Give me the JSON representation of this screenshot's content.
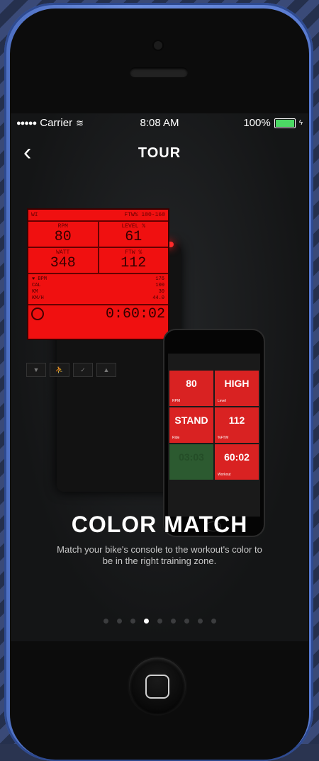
{
  "status_bar": {
    "carrier": "Carrier",
    "time": "8:08 AM",
    "battery": "100%"
  },
  "nav": {
    "back": "‹",
    "title": "TOUR"
  },
  "console": {
    "header_left": "WI",
    "header_right": "FTW% 100-160",
    "rows": [
      {
        "label1": "RPM",
        "value1": "80",
        "label2": "LEVEL %",
        "value2": "61"
      },
      {
        "label1": "WATT",
        "value1": "348",
        "label2": "FTW %",
        "value2": "112"
      }
    ],
    "list": [
      {
        "k": "♥ BPM",
        "v": "176"
      },
      {
        "k": "CAL",
        "v": "100"
      },
      {
        "k": "KM",
        "v": "30"
      },
      {
        "k": "KM/H",
        "v": "44.0"
      }
    ],
    "timer": "0:60:02"
  },
  "mini_app": {
    "tiles": [
      {
        "value": "80",
        "caption": "RPM"
      },
      {
        "value": "HIGH",
        "caption": "Level"
      },
      {
        "value": "STAND",
        "caption": "Ride"
      },
      {
        "value": "112",
        "caption": "%FTW"
      },
      {
        "value": "03:03",
        "caption": ""
      },
      {
        "value": "60:02",
        "caption": "Workout"
      }
    ]
  },
  "slide": {
    "headline": "COLOR MATCH",
    "description": "Match your bike's console to the workout's color to be in the right training zone."
  },
  "pager": {
    "count": 9,
    "active_index": 3
  },
  "colors": {
    "accent_red": "#f01010",
    "battery_green": "#4cd964"
  }
}
